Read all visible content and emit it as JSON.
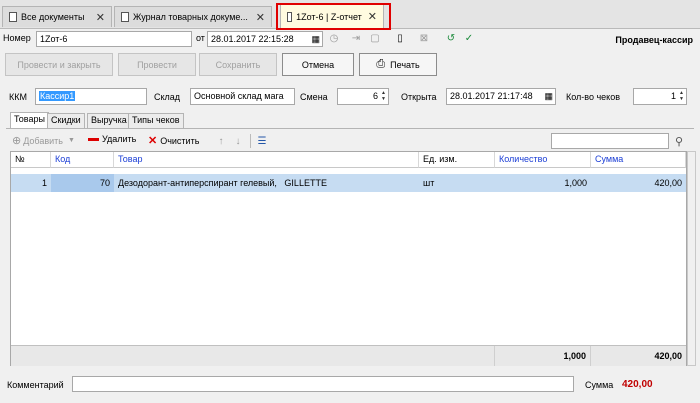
{
  "tabs": [
    {
      "label": "Все документы",
      "close": "✕"
    },
    {
      "label": "Журнал товарных докуме...",
      "close": "✕"
    },
    {
      "label": "1Zот-6 | Z-отчет",
      "close": "✕"
    }
  ],
  "form": {
    "nomer_label": "Номер",
    "nomer_value": "1Zот-6",
    "ot_label": "от",
    "date_value": "28.01.2017 22:15:28",
    "seller": "Продавец-кассир"
  },
  "buttons": {
    "post_close": "Провести и закрыть",
    "post": "Провести",
    "save": "Сохранить",
    "cancel": "Отмена",
    "print": "Печать"
  },
  "fields": {
    "kkm_label": "ККМ",
    "kkm_value": "Кассир1",
    "sklad_label": "Склад",
    "sklad_value": "Основной склад мага",
    "smena_label": "Смена",
    "smena_value": "6",
    "otkryta_label": "Открыта",
    "otkryta_value": "28.01.2017 21:17:48",
    "checks_label": "Кол-во чеков",
    "checks_value": "1"
  },
  "inner_tabs": [
    "Товары",
    "Скидки",
    "Выручка",
    "Типы чеков"
  ],
  "toolbar": {
    "add": "Добавить",
    "delete": "Удалить",
    "clear": "Очистить"
  },
  "table": {
    "columns": [
      "№",
      "Код",
      "Товар",
      "Ед. изм.",
      "Количество",
      "Сумма"
    ],
    "rows": [
      {
        "n": "1",
        "code": "70",
        "item": "Дезодорант-антиперспирант гелевый,   GILLETTE",
        "unit": "шт",
        "qty": "1,000",
        "sum": "420,00"
      }
    ],
    "total_qty": "1,000",
    "total_sum": "420,00"
  },
  "bottom": {
    "comment_label": "Комментарий",
    "comment_value": "",
    "sum_label": "Сумма",
    "sum_value": "420,00"
  },
  "colors": {
    "accent_red": "#c00000",
    "selected_row": "#c6dcf2",
    "header_blue": "#1c3fd6",
    "highlight_box": "#e00000"
  }
}
